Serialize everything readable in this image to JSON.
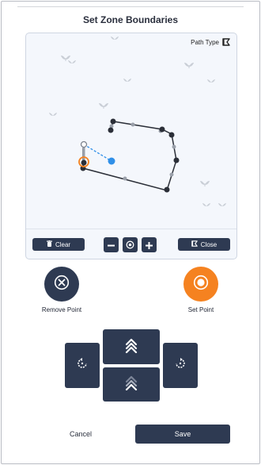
{
  "header": {
    "title": "Set Zone Boundaries"
  },
  "map": {
    "path_type_label": "Path Type",
    "path_type_icon": "path-type-icon"
  },
  "map_toolbar": {
    "clear_label": "Clear",
    "clear_icon": "trash-icon",
    "close_label": "Close",
    "close_icon": "path-type-icon",
    "zoom_out_icon": "minus-icon",
    "zoom_center_icon": "target-icon",
    "zoom_in_icon": "plus-icon"
  },
  "actions": {
    "remove_point_label": "Remove Point",
    "remove_point_icon": "close-circle-icon",
    "set_point_label": "Set Point",
    "set_point_icon": "target-icon"
  },
  "dpad": {
    "up_icon": "double-chevron-up-icon",
    "down_icon": "chevron-up-faded-icon",
    "left_icon": "rotate-left-icon",
    "right_icon": "rotate-right-icon"
  },
  "footer": {
    "cancel_label": "Cancel",
    "save_label": "Save"
  },
  "colors": {
    "primary_dark": "#2e3a52",
    "accent_orange": "#f58220",
    "map_background": "#f4f7fc",
    "preview_blue": "#2f8fe8"
  }
}
